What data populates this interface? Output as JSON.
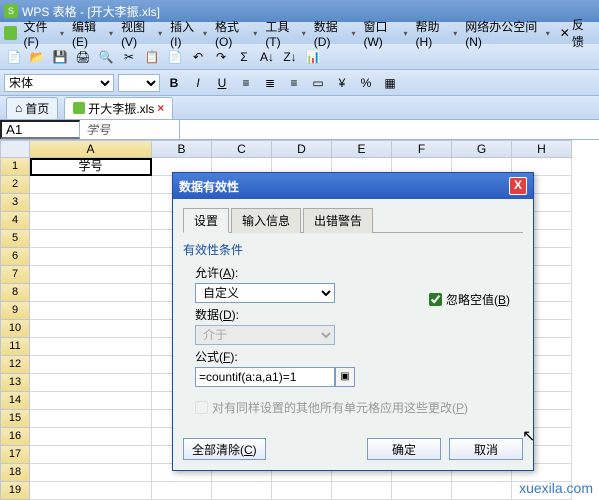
{
  "title": "WPS 表格 - [开大李振.xls]",
  "menus": [
    "文件(F)",
    "编辑(E)",
    "视图(V)",
    "插入(I)",
    "格式(O)",
    "工具(T)",
    "数据(D)",
    "窗口(W)",
    "帮助(H)",
    "网络办公空间(N)"
  ],
  "feedback": "反馈",
  "font": {
    "name": "宋体",
    "size": ""
  },
  "tabs": {
    "home": "首页",
    "file": "开大李振.xls"
  },
  "namebox": "A1",
  "fxlabel": "学号",
  "columns": [
    "A",
    "B",
    "C",
    "D",
    "E",
    "F",
    "G",
    "H"
  ],
  "rowcount": 19,
  "cellA1": "学号",
  "dialog": {
    "title": "数据有效性",
    "tabs": [
      "设置",
      "输入信息",
      "出错警告"
    ],
    "group": "有效性条件",
    "allow_label": "允许(A):",
    "allow_value": "自定义",
    "ignore_blank": "忽略空值(B)",
    "data_label": "数据(D):",
    "data_value": "介于",
    "formula_label": "公式(F):",
    "formula_value": "=countif(a:a,a1)=1",
    "apply_all": "对有同样设置的其他所有单元格应用这些更改(P)",
    "clear": "全部清除(C)",
    "ok": "确定",
    "cancel": "取消"
  },
  "watermark": "xuexila.com"
}
